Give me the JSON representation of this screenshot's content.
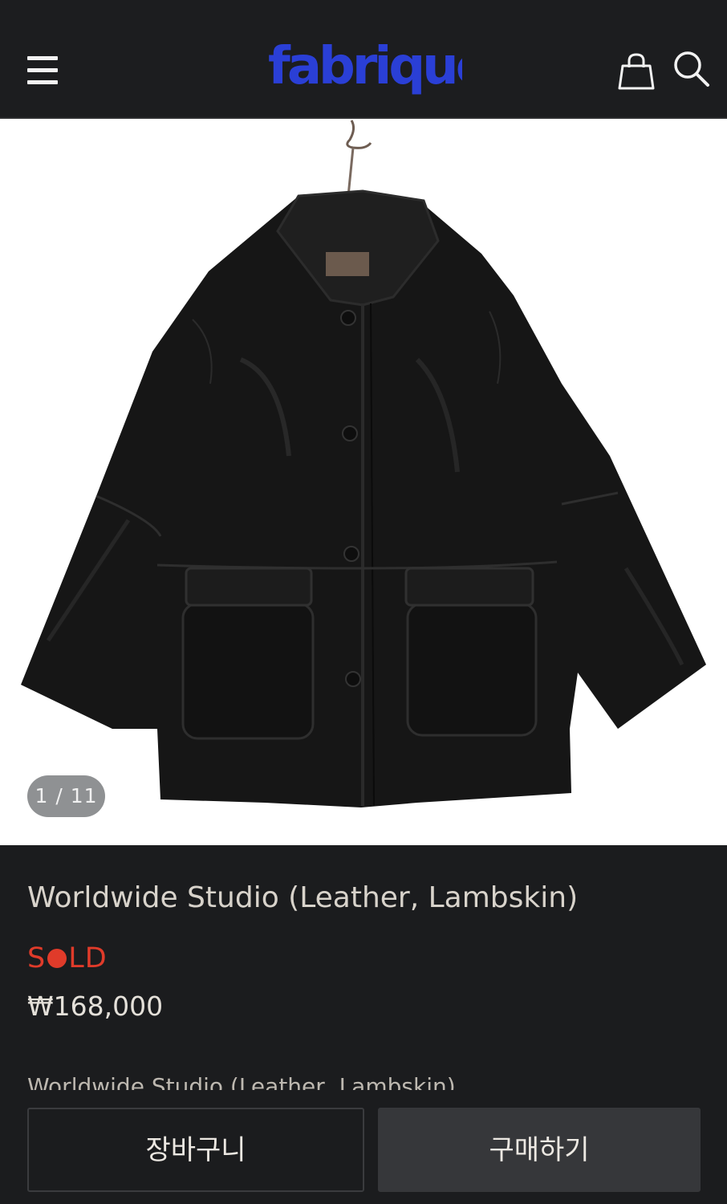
{
  "header": {
    "logo_text": "fabrique",
    "menu_icon": "hamburger-menu-icon",
    "cart_icon": "shopping-bag-icon",
    "search_icon": "search-icon",
    "brand_color": "#2a3fd6"
  },
  "gallery": {
    "image_alt": "Black leather jacket on hanger",
    "counter": "1 / 11"
  },
  "product": {
    "title": "Worldwide Studio (Leather, Lambskin)",
    "status": "SOLD",
    "status_color": "#e03b2a",
    "price": "₩168,000",
    "description": "Worldwide Studio (Leather, Lambskin)"
  },
  "actions": {
    "cart_label": "장바구니",
    "buy_label": "구매하기"
  }
}
